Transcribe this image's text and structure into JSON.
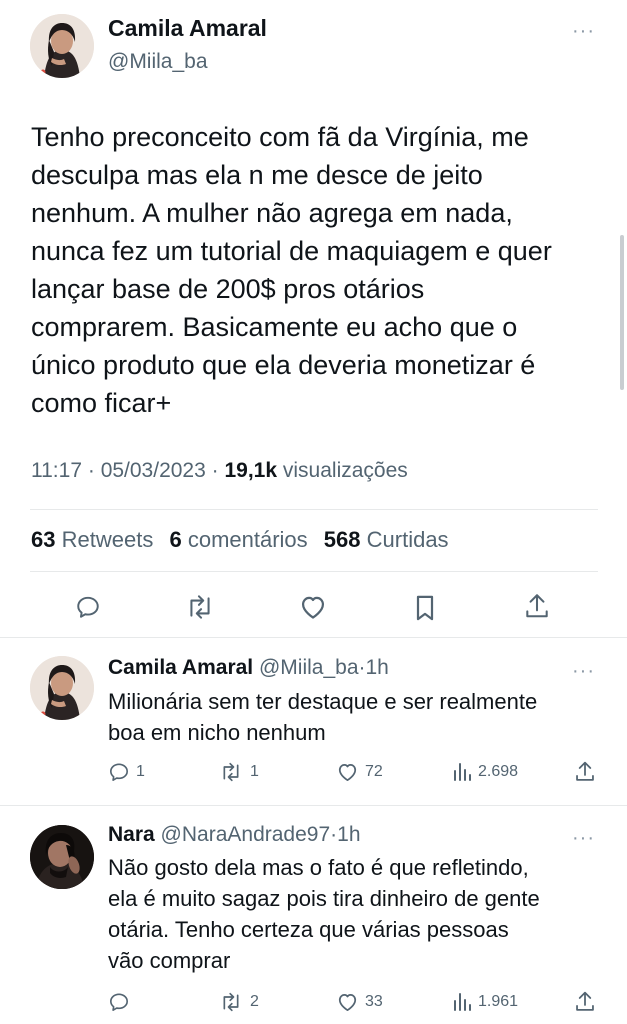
{
  "main_tweet": {
    "name": "Camila Amaral",
    "handle": "@Miila_ba",
    "text_lines": [
      "Tenho preconceito com fã da Virgínia, me",
      "desculpa mas ela n me desce de jeito",
      "nenhum. A mulher não agrega em nada,",
      "nunca fez um tutorial de maquiagem e quer",
      "lançar base de 200$ pros otários",
      "comprarem. Basicamente eu acho que o",
      "único produto que ela deveria monetizar é",
      "como ficar+"
    ],
    "time": "11:17",
    "date": "05/03/2023",
    "views_count": "19,1k",
    "views_label": "visualizações",
    "retweets_count": "63",
    "retweets_label": "Retweets",
    "comments_count": "6",
    "comments_label": "comentários",
    "likes_count": "568",
    "likes_label": "Curtidas"
  },
  "replies": [
    {
      "name": "Camila Amaral",
      "handle": "@Miila_ba",
      "time": "1h",
      "text_lines": [
        "Milionária sem ter destaque e ser realmente",
        "boa em nicho nenhum"
      ],
      "replies": "1",
      "retweets": "1",
      "likes": "72",
      "views": "2.698"
    },
    {
      "name": "Nara",
      "handle": "@NaraAndrade97",
      "time": "1h",
      "text_lines": [
        "Não gosto dela mas o fato é que refletindo,",
        "ela é muito sagaz pois tira dinheiro de gente",
        "otária. Tenho certeza que várias pessoas",
        "vão comprar"
      ],
      "replies": "",
      "retweets": "2",
      "likes": "33",
      "views": "1.961"
    }
  ],
  "icons": {
    "reply": "reply-icon",
    "retweet": "retweet-icon",
    "like": "heart-icon",
    "bookmark": "bookmark-icon",
    "share": "share-icon",
    "views": "views-icon",
    "more": "more-icon"
  },
  "colors": {
    "text": "#0f1419",
    "secondary": "#536471",
    "divider": "#e7e9ea"
  }
}
